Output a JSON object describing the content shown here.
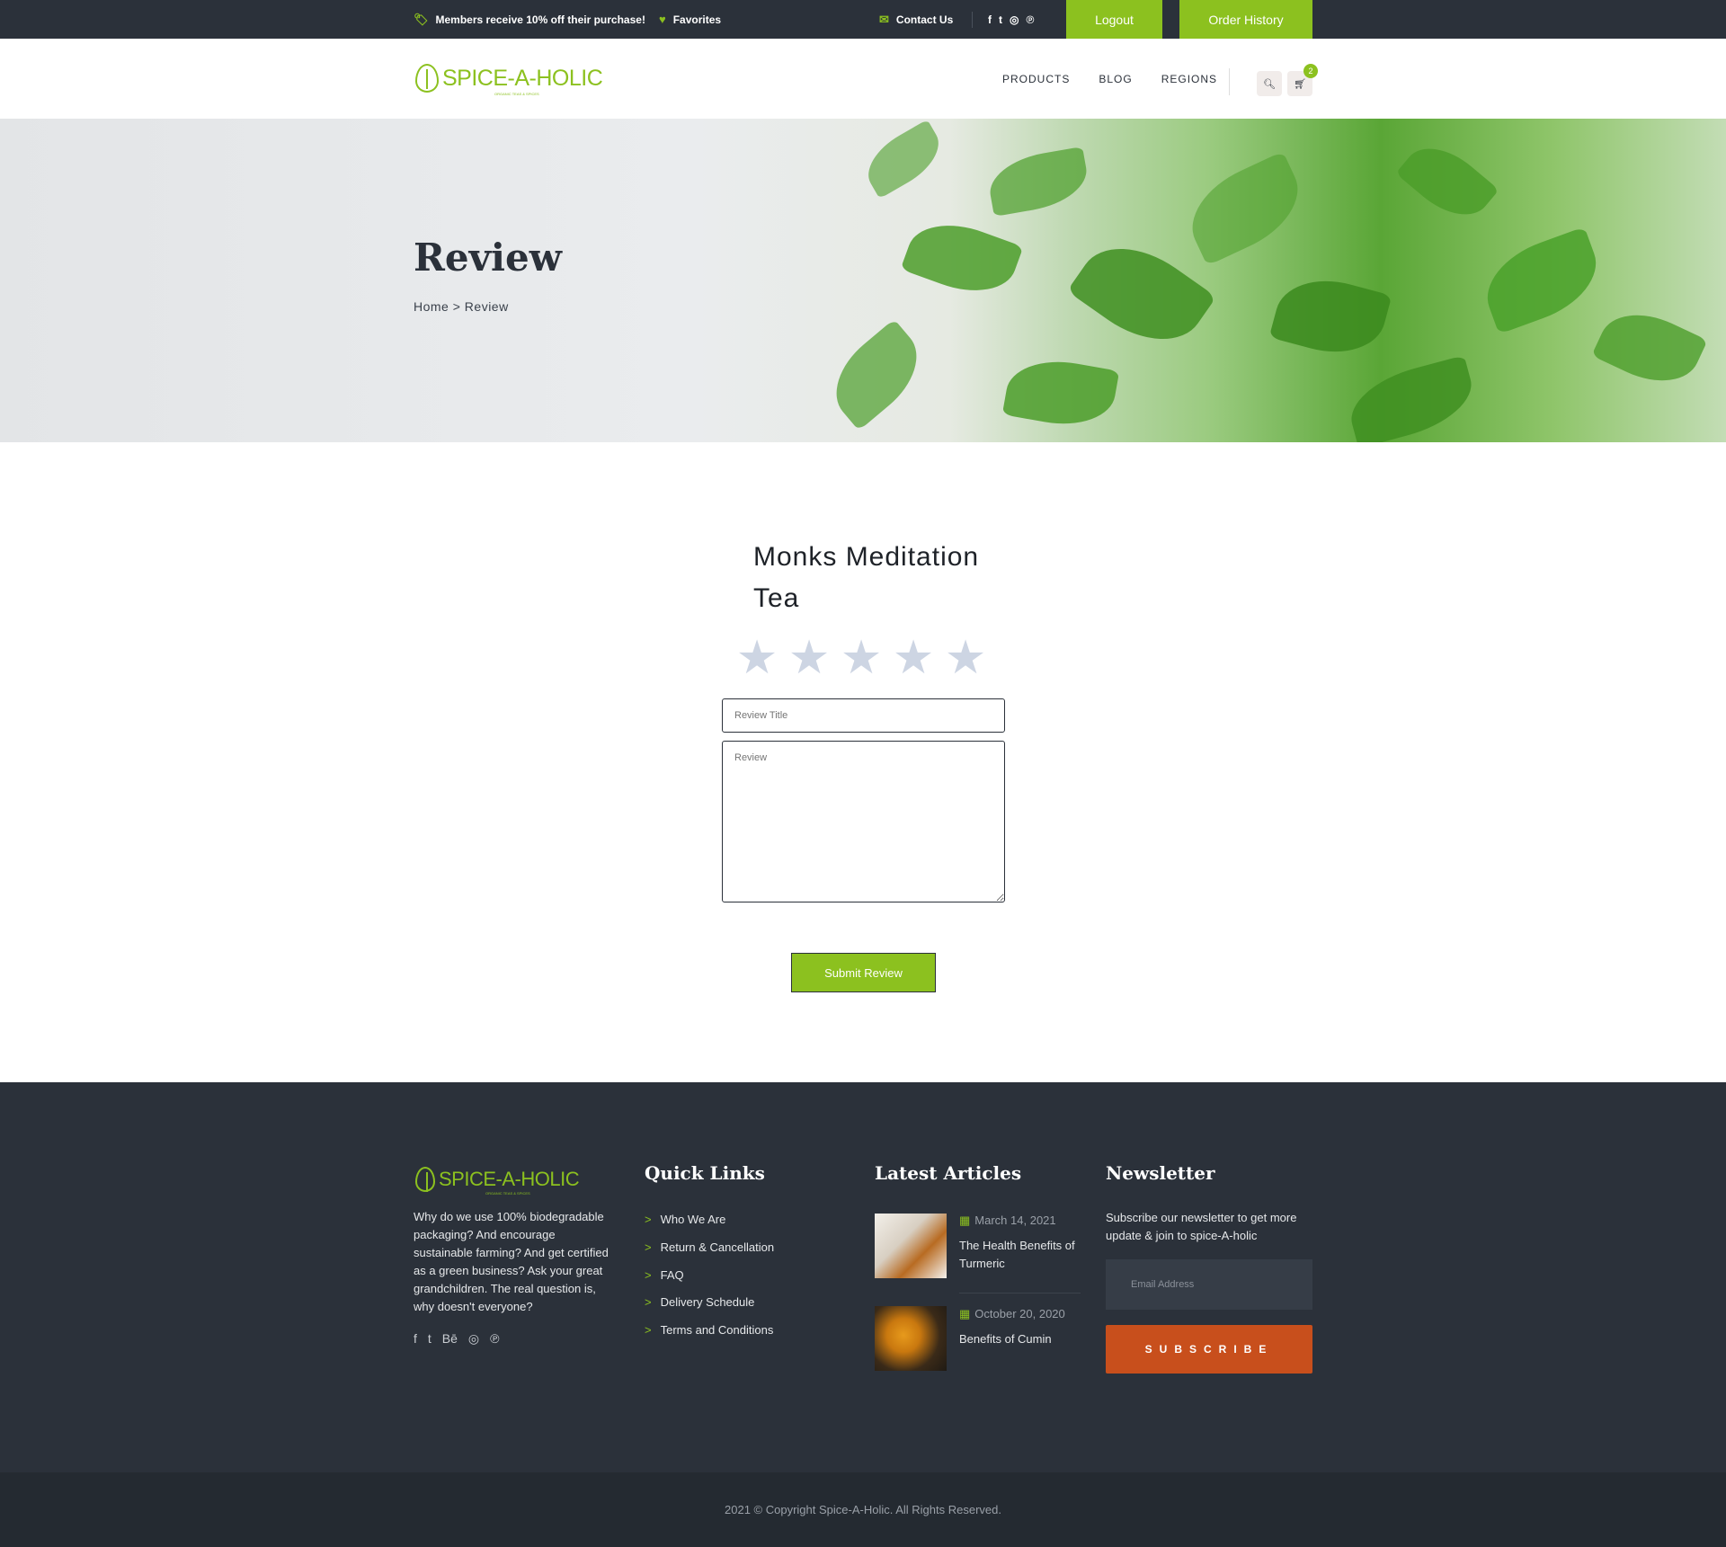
{
  "topbar": {
    "promo": "Members receive 10% off their purchase!",
    "favorites": "Favorites",
    "contact": "Contact Us",
    "social": [
      "f",
      "t",
      "◎",
      "℗"
    ],
    "logout": "Logout",
    "order_history": "Order History"
  },
  "header": {
    "logo_text": "SPICE-A-HOLIC",
    "logo_sub": "ORGANIC TEAS & SPICES",
    "nav": [
      "PRODUCTS",
      "BLOG",
      "REGIONS"
    ],
    "cart_count": "2"
  },
  "hero": {
    "title": "Review",
    "breadcrumb": "Home > Review"
  },
  "review": {
    "product_name": "Monks Meditation Tea",
    "rating": 0,
    "title_placeholder": "Review Title",
    "review_placeholder": "Review",
    "submit_label": "Submit Review"
  },
  "footer": {
    "logo_text": "SPICE-A-HOLIC",
    "logo_sub": "ORGANIC TEAS & SPICES",
    "about": "Why do we use 100% biodegradable packaging? And encourage sustainable farming? And get certified as a green business? Ask your great grandchildren. The real question is, why doesn't everyone?",
    "social": [
      "f",
      "t",
      "Bē",
      "◎",
      "℗"
    ],
    "quick_links_title": "Quick Links",
    "quick_links": [
      "Who We Are",
      "Return & Cancellation",
      "FAQ",
      "Delivery Schedule",
      "Terms and Conditions"
    ],
    "articles_title": "Latest Articles",
    "articles": [
      {
        "date": "March 14, 2021",
        "title": "The Health Benefits of Turmeric"
      },
      {
        "date": "October 20, 2020",
        "title": "Benefits of Cumin"
      }
    ],
    "newsletter_title": "Newsletter",
    "newsletter_text": "Subscribe our newsletter to get more update & join to spice-A-holic",
    "email_placeholder": "Email Address",
    "subscribe_label": "SUBSCRIBE"
  },
  "copyright": "2021 © Copyright Spice-A-Holic. All Rights Reserved.",
  "colors": {
    "accent": "#8cc11f",
    "dark": "#2b313a",
    "subscribe": "#c84f1c"
  }
}
